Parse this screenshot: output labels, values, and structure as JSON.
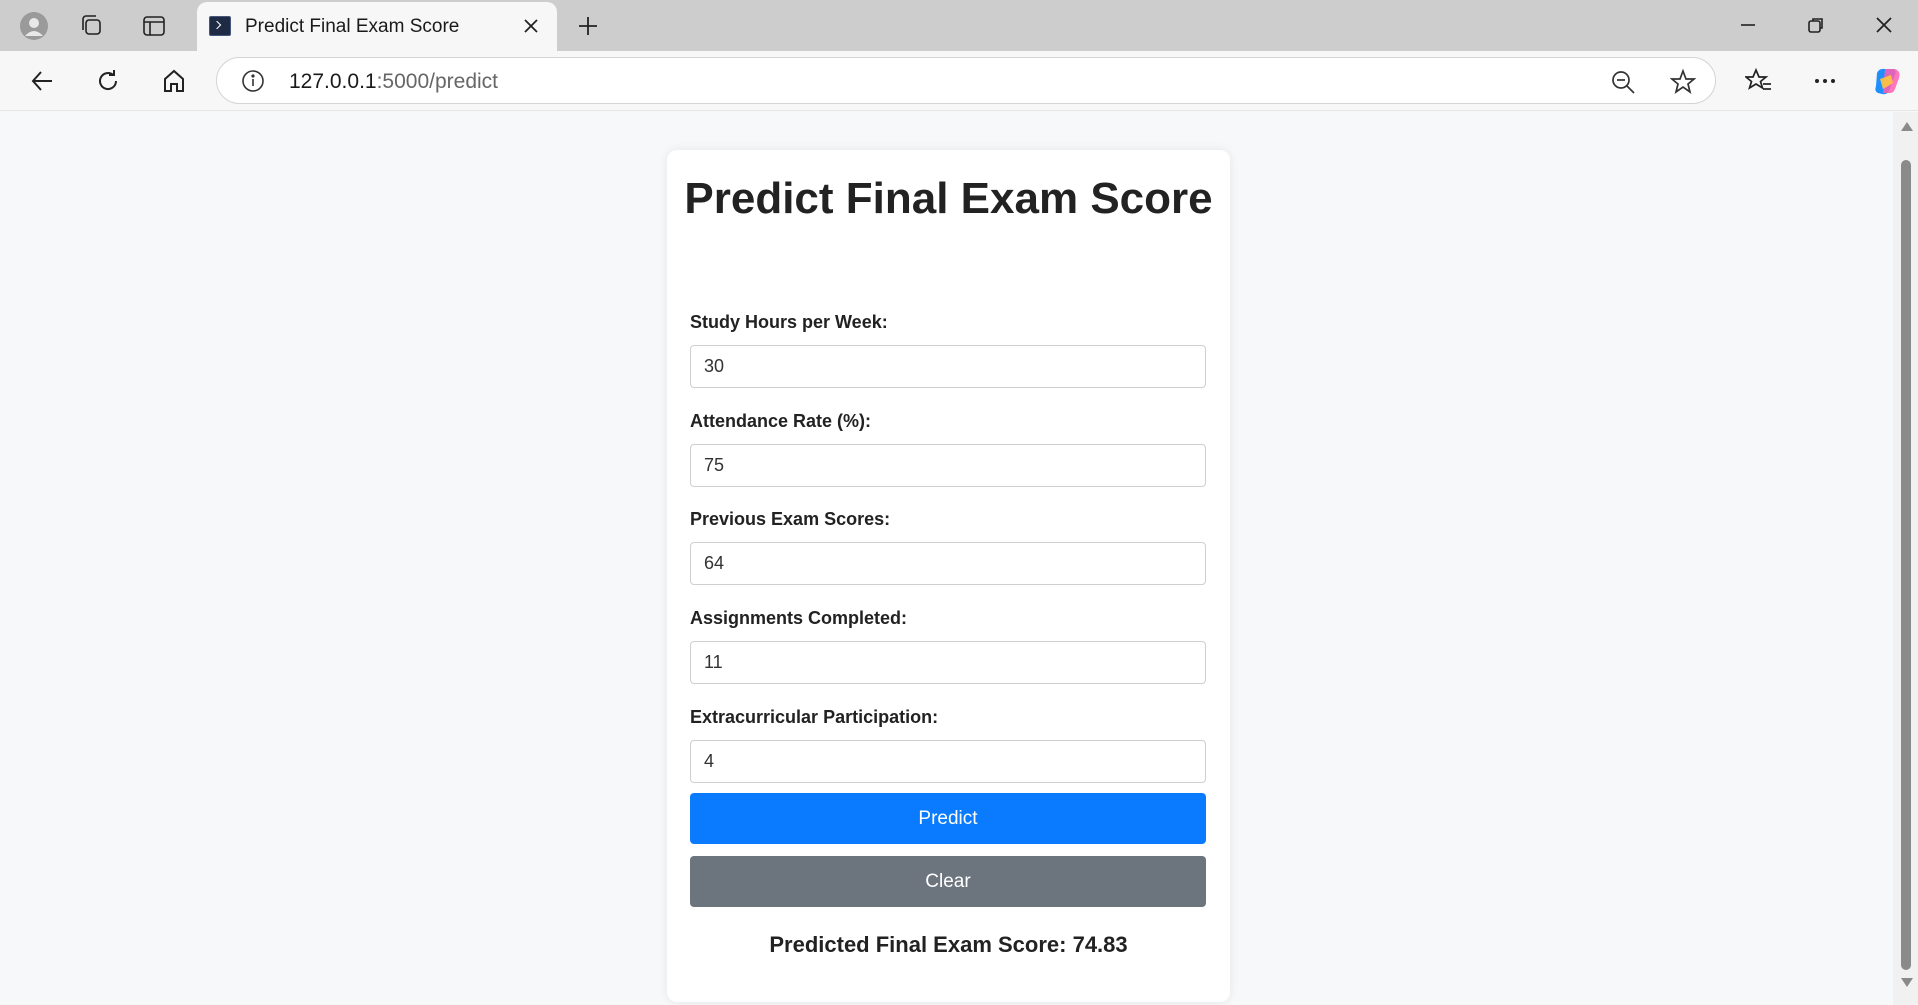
{
  "browser": {
    "tab_title": "Predict Final Exam Score",
    "url_host": "127.0.0.1",
    "url_path": ":5000/predict"
  },
  "icons": {
    "profile": "profile-avatar-icon",
    "workspaces": "workspaces-icon",
    "tab_actions": "tab-actions-icon",
    "back": "back-arrow-icon",
    "refresh": "refresh-icon",
    "home": "home-icon",
    "site_info": "info-icon",
    "zoom": "zoom-out-icon",
    "favorite": "star-icon",
    "favorites": "favorites-icon",
    "more": "more-icon",
    "copilot": "copilot-icon"
  },
  "page": {
    "title": "Predict Final Exam Score",
    "fields": [
      {
        "label": "Study Hours per Week:",
        "value": "30"
      },
      {
        "label": "Attendance Rate (%):",
        "value": "75"
      },
      {
        "label": "Previous Exam Scores:",
        "value": "64"
      },
      {
        "label": "Assignments Completed:",
        "value": "11"
      },
      {
        "label": "Extracurricular Participation:",
        "value": "4"
      }
    ],
    "predict_label": "Predict",
    "clear_label": "Clear",
    "result": "Predicted Final Exam Score: 74.83"
  },
  "colors": {
    "predict_button": "#0a7bff",
    "clear_button": "#6c757d",
    "page_background": "#f7f8fa"
  }
}
